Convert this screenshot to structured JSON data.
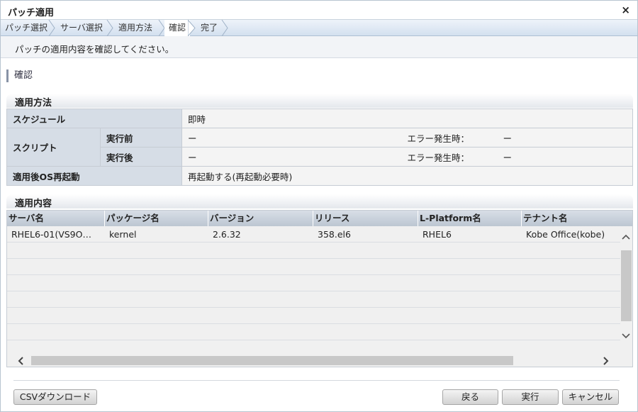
{
  "dialog": {
    "title": "パッチ適用",
    "close_label": "×"
  },
  "wizard": {
    "steps": [
      "パッチ選択",
      "サーバ選択",
      "適用方法",
      "確認",
      "完了"
    ],
    "active_index": 3
  },
  "message": "パッチの適用内容を確認してください。",
  "section_title": "確認",
  "method": {
    "header": "適用方法",
    "schedule_label": "スケジュール",
    "schedule_value": "即時",
    "script_label": "スクリプト",
    "pre_label": "実行前",
    "pre_value": "ー",
    "pre_error_label": "エラー発生時：",
    "pre_error_value": "ー",
    "post_label": "実行後",
    "post_value": "ー",
    "post_error_label": "エラー発生時：",
    "post_error_value": "ー",
    "reboot_label": "適用後OS再起動",
    "reboot_value": "再起動する(再起動必要時)"
  },
  "content": {
    "header": "適用内容",
    "columns": [
      "サーバ名",
      "パッケージ名",
      "バージョン",
      "リリース",
      "L-Platform名",
      "テナント名"
    ],
    "rows": [
      [
        "RHEL6-01(VS9O…",
        "kernel",
        "2.6.32",
        "358.el6",
        "RHEL6",
        "Kobe Office(kobe)"
      ]
    ]
  },
  "buttons": {
    "csv": "CSVダウンロード",
    "back": "戻る",
    "execute": "実行",
    "cancel": "キャンセル"
  }
}
